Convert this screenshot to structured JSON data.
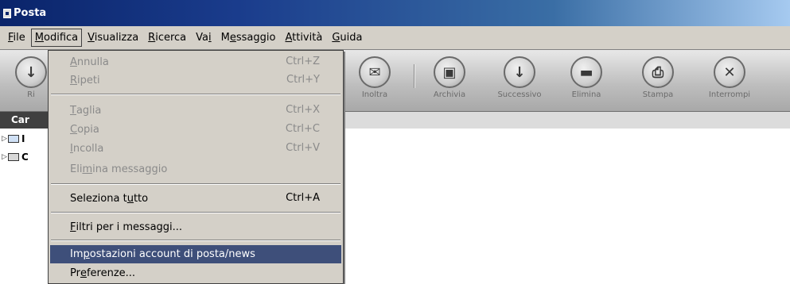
{
  "window": {
    "title": "Posta"
  },
  "menubar": {
    "items": [
      {
        "key": "file",
        "pre": "",
        "ul": "F",
        "post": "ile"
      },
      {
        "key": "modifica",
        "pre": "",
        "ul": "M",
        "post": "odifica"
      },
      {
        "key": "visualizza",
        "pre": "",
        "ul": "V",
        "post": "isualizza"
      },
      {
        "key": "ricerca",
        "pre": "",
        "ul": "R",
        "post": "icerca"
      },
      {
        "key": "vai",
        "pre": "Va",
        "ul": "i",
        "post": ""
      },
      {
        "key": "messaggio",
        "pre": "M",
        "ul": "e",
        "post": "ssaggio"
      },
      {
        "key": "attivita",
        "pre": "",
        "ul": "A",
        "post": "ttività"
      },
      {
        "key": "guida",
        "pre": "",
        "ul": "G",
        "post": "uida"
      }
    ]
  },
  "toolbar": {
    "buttons": [
      {
        "label": "Ri",
        "icon": "receive-icon"
      },
      {
        "label": "Inoltra",
        "icon": "forward-icon"
      },
      {
        "label": "Archivia",
        "icon": "archive-icon"
      },
      {
        "label": "Successivo",
        "icon": "next-icon"
      },
      {
        "label": "Elimina",
        "icon": "delete-icon"
      },
      {
        "label": "Stampa",
        "icon": "print-icon"
      },
      {
        "label": "Interrompi",
        "icon": "stop-icon"
      }
    ]
  },
  "folder_pane": {
    "header": "Car",
    "items": [
      {
        "label": "I",
        "icon": "mail-account-icon"
      },
      {
        "label": "C",
        "icon": "local-folders-icon"
      }
    ]
  },
  "dropdown": {
    "items": [
      {
        "pre": "",
        "ul": "A",
        "post": "nnulla",
        "shortcut": "Ctrl+Z",
        "disabled": true
      },
      {
        "pre": "",
        "ul": "R",
        "post": "ipeti",
        "shortcut": "Ctrl+Y",
        "disabled": true
      },
      {
        "pre": "",
        "ul": "T",
        "post": "aglia",
        "shortcut": "Ctrl+X",
        "disabled": true
      },
      {
        "pre": "",
        "ul": "C",
        "post": "opia",
        "shortcut": "Ctrl+C",
        "disabled": true
      },
      {
        "pre": "",
        "ul": "I",
        "post": "ncolla",
        "shortcut": "Ctrl+V",
        "disabled": true
      },
      {
        "pre": "Eli",
        "ul": "m",
        "post": "ina messaggio",
        "shortcut": "",
        "disabled": true
      },
      {
        "pre": "Seleziona t",
        "ul": "u",
        "post": "tto",
        "shortcut": "Ctrl+A",
        "disabled": false
      },
      {
        "pre": "",
        "ul": "F",
        "post": "iltri per i messaggi...",
        "shortcut": "",
        "disabled": false
      },
      {
        "pre": "Im",
        "ul": "p",
        "post": "ostazioni account di posta/news",
        "shortcut": "",
        "disabled": false,
        "highlighted": true
      },
      {
        "pre": "Pr",
        "ul": "e",
        "post": "ferenze...",
        "shortcut": "",
        "disabled": false
      }
    ]
  },
  "colors": {
    "highlight": "#3e4f7a",
    "menu_bg": "#d4d0c8",
    "title_dark": "#0a246a"
  }
}
